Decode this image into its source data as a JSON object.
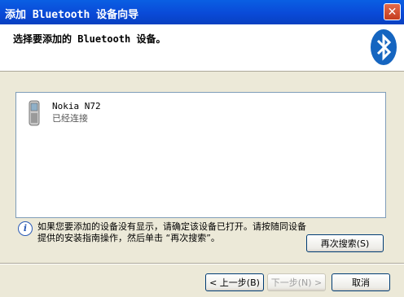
{
  "window": {
    "title": "添加 Bluetooth 设备向导",
    "close_label": "✕"
  },
  "header": {
    "heading": "选择要添加的 Bluetooth 设备。"
  },
  "devices": [
    {
      "name": "Nokia N72",
      "status": "已经连接"
    }
  ],
  "info": {
    "text": "如果您要添加的设备没有显示，请确定该设备已打开。请按随同设备提供的安装指南操作，然后单击 “再次搜索”。"
  },
  "buttons": {
    "rescan": "再次搜索(S)",
    "back": "< 上一步(B)",
    "next": "下一步(N) >",
    "cancel": "取消"
  },
  "colors": {
    "titlebar": "#0a4ad8",
    "bluetooth_logo": "#1565c0"
  }
}
